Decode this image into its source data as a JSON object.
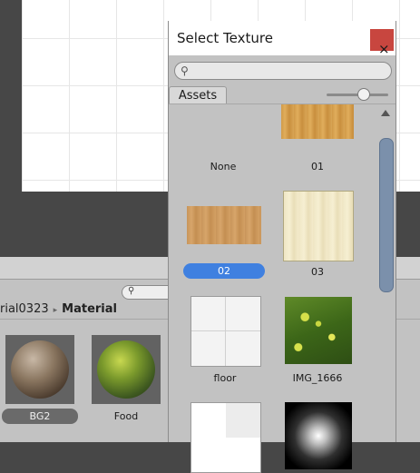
{
  "scene": {
    "description_free": ""
  },
  "project": {
    "breadcrumb": {
      "parent": "rial0323",
      "separator": "▸",
      "current": "Material"
    },
    "assets": [
      {
        "label": "BG2",
        "selected": true
      },
      {
        "label": "Food",
        "selected": false
      }
    ]
  },
  "dialog": {
    "title": "Select Texture",
    "close_glyph": "×",
    "search": {
      "placeholder": "",
      "value": ""
    },
    "tab": "Assets",
    "zoom_level": 0.55,
    "textures": [
      {
        "label": "None",
        "selected": false
      },
      {
        "label": "01",
        "selected": false
      },
      {
        "label": "02",
        "selected": true
      },
      {
        "label": "03",
        "selected": false
      },
      {
        "label": "floor",
        "selected": false
      },
      {
        "label": "IMG_1666",
        "selected": false
      },
      {
        "label": "",
        "selected": false
      },
      {
        "label": "",
        "selected": false
      }
    ]
  },
  "colors": {
    "selection_blue": "#3f80e0",
    "close_red": "#c8463f",
    "scrollbar_thumb": "#7b90ab"
  },
  "icons": {
    "search": "magnifier-icon",
    "close": "close-icon",
    "scroll_up": "arrow-up-icon"
  }
}
